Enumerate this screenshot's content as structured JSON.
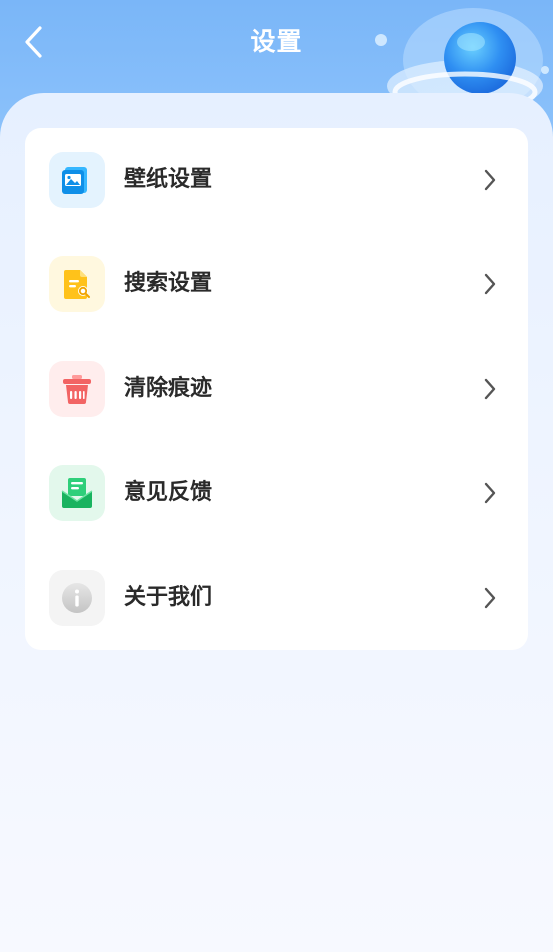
{
  "header": {
    "title": "设置",
    "back_icon": "chevron-left-icon"
  },
  "menu": {
    "items": [
      {
        "label": "壁纸设置",
        "icon": "wallpaper-icon",
        "color": "#1aa0f5"
      },
      {
        "label": "搜索设置",
        "icon": "search-doc-icon",
        "color": "#f5b800"
      },
      {
        "label": "清除痕迹",
        "icon": "trash-icon",
        "color": "#f26464"
      },
      {
        "label": "意见反馈",
        "icon": "feedback-mail-icon",
        "color": "#22c06a"
      },
      {
        "label": "关于我们",
        "icon": "info-icon",
        "color": "#c8c8c8"
      }
    ]
  },
  "colors": {
    "header_bg": "#7ab6f8",
    "card_bg": "#ffffff",
    "text": "#2a2a2a"
  }
}
